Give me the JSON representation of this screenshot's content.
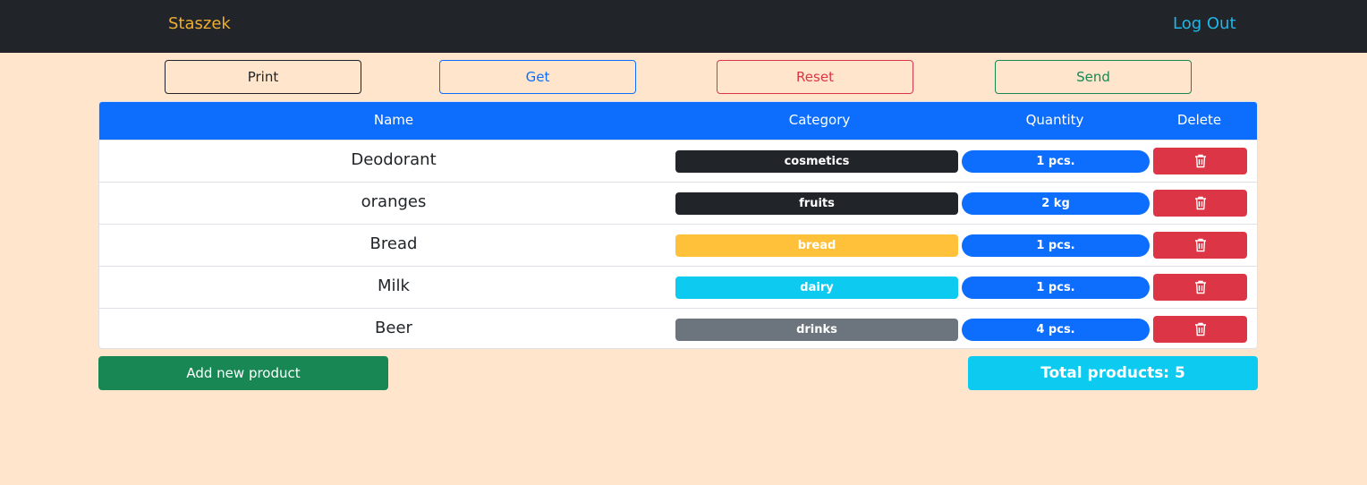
{
  "navbar": {
    "brand": "Staszek",
    "logout": "Log Out"
  },
  "toolbar": {
    "print": "Print",
    "get": "Get",
    "reset": "Reset",
    "send": "Send"
  },
  "table": {
    "headers": {
      "name": "Name",
      "category": "Category",
      "quantity": "Quantity",
      "delete": "Delete"
    },
    "rows": [
      {
        "name": "Deodorant",
        "category": "cosmetics",
        "category_color": "#212529",
        "quantity": "1 pcs."
      },
      {
        "name": "oranges",
        "category": "fruits",
        "category_color": "#212529",
        "quantity": "2 kg"
      },
      {
        "name": "Bread",
        "category": "bread",
        "category_color": "#ffc13a",
        "quantity": "1 pcs."
      },
      {
        "name": "Milk",
        "category": "dairy",
        "category_color": "#0dcaf0",
        "quantity": "1 pcs."
      },
      {
        "name": "Beer",
        "category": "drinks",
        "category_color": "#6c757d",
        "quantity": "4 pcs."
      }
    ],
    "delete_icon": "trash-icon"
  },
  "footer": {
    "add_label": "Add new product",
    "total_label": "Total products: 5"
  },
  "colors": {
    "primary": "#0d6efd",
    "danger": "#dc3545",
    "success": "#198754",
    "info": "#0dcaf0",
    "dark": "#212529",
    "background": "#ffe5cc"
  }
}
